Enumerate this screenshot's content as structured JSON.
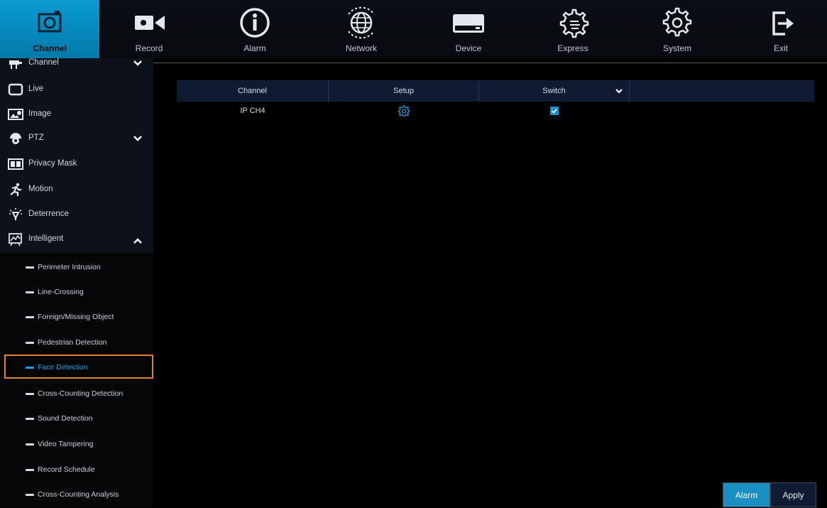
{
  "nav": {
    "items": [
      {
        "label": "Channel",
        "icon": "camera-icon"
      },
      {
        "label": "Record",
        "icon": "video-record-icon"
      },
      {
        "label": "Alarm",
        "icon": "info-icon"
      },
      {
        "label": "Network",
        "icon": "globe-icon"
      },
      {
        "label": "Device",
        "icon": "hard-drive-icon"
      },
      {
        "label": "Express",
        "icon": "gear-hand-icon"
      },
      {
        "label": "System",
        "icon": "gear-icon"
      },
      {
        "label": "Exit",
        "icon": "exit-icon"
      }
    ],
    "active": "Channel"
  },
  "sidebar": {
    "items": [
      {
        "label": "Channel",
        "icon": "cctv-icon"
      },
      {
        "label": "Live",
        "icon": "monitor-icon"
      },
      {
        "label": "Image",
        "icon": "image-settings-icon"
      },
      {
        "label": "PTZ",
        "icon": "dome-camera-icon"
      },
      {
        "label": "Privacy Mask",
        "icon": "mask-icon"
      },
      {
        "label": "Motion",
        "icon": "running-man-icon"
      },
      {
        "label": "Deterrence",
        "icon": "light-bulb-icon"
      },
      {
        "label": "Intelligent",
        "icon": "analytics-board-icon"
      }
    ],
    "sub_items": [
      "Perimeter Intrusion",
      "Line-Crossing",
      "Foreign/Missing Object",
      "Pedestrian Detection",
      "Face Detection",
      "Cross-Counting Detection",
      "Sound Detection",
      "Video Tampering",
      "Record Schedule",
      "Cross-Counting Analysis"
    ],
    "selected_sub": "Face Detection"
  },
  "table": {
    "headers": [
      "Channel",
      "Setup",
      "Switch"
    ],
    "rows": [
      {
        "channel": "IP CH4",
        "switch_checked": true
      }
    ]
  },
  "buttons": {
    "alarm": "Alarm",
    "apply": "Apply"
  },
  "colors": {
    "accent": "#0a9bd1",
    "selection_outline": "#e0822a",
    "header_bg": "#0e1b33"
  }
}
